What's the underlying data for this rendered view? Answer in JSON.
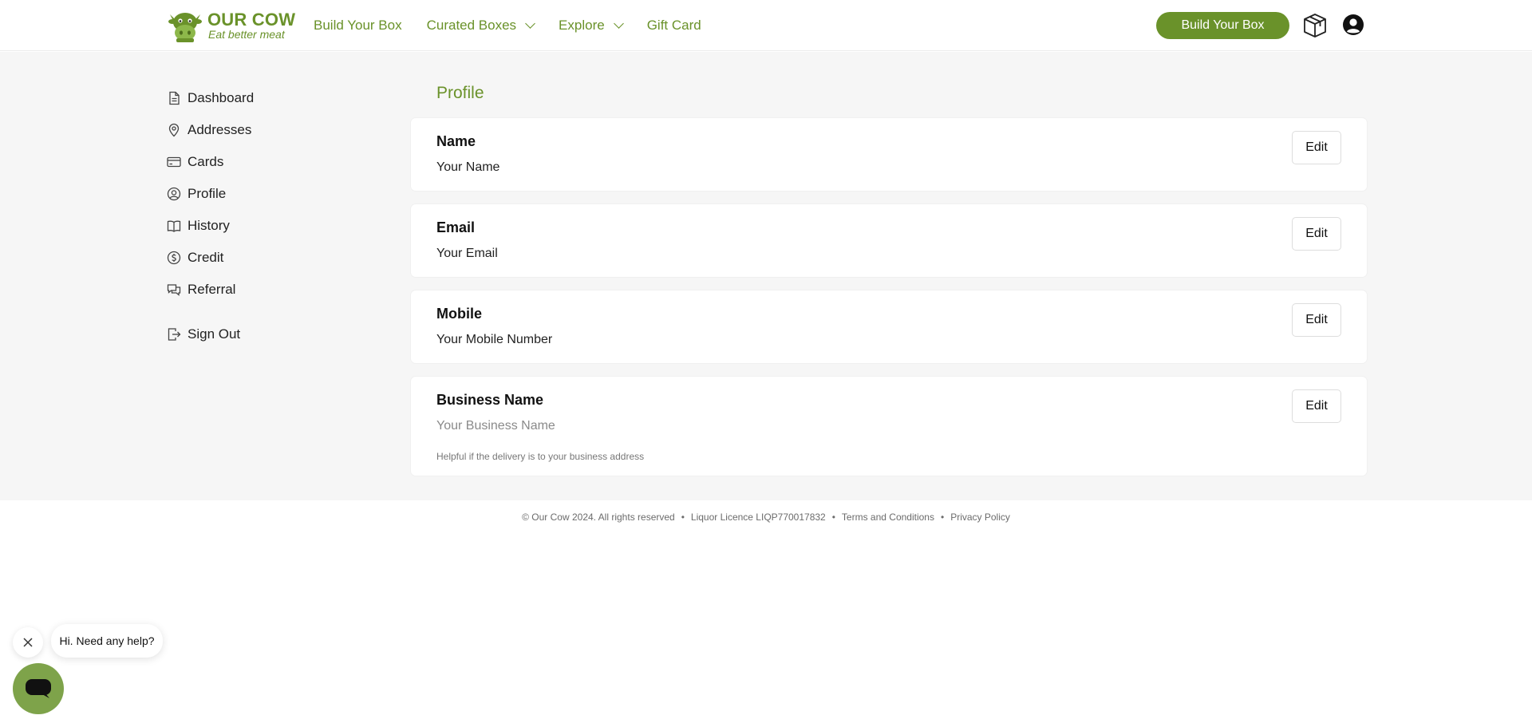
{
  "header": {
    "logo": {
      "brand": "OUR COW",
      "tagline": "Eat better meat"
    },
    "nav": [
      {
        "label": "Build Your Box",
        "dropdown": false
      },
      {
        "label": "Curated Boxes",
        "dropdown": true
      },
      {
        "label": "Explore",
        "dropdown": true
      },
      {
        "label": "Gift Card",
        "dropdown": false
      }
    ],
    "cta_label": "Build Your Box",
    "icons": [
      "box-icon",
      "user-icon"
    ],
    "accent": "#6a922a"
  },
  "sidebar": {
    "items": [
      {
        "label": "Dashboard",
        "icon": "document-icon"
      },
      {
        "label": "Addresses",
        "icon": "location-pin-icon"
      },
      {
        "label": "Cards",
        "icon": "credit-card-icon"
      },
      {
        "label": "Profile",
        "icon": "user-circle-icon"
      },
      {
        "label": "History",
        "icon": "book-icon"
      },
      {
        "label": "Credit",
        "icon": "dollar-circle-icon"
      },
      {
        "label": "Referral",
        "icon": "chat-bubbles-icon"
      }
    ],
    "signout": {
      "label": "Sign Out",
      "icon": "sign-out-icon"
    }
  },
  "profile": {
    "title": "Profile",
    "fields": [
      {
        "label": "Name",
        "value": "Your Name",
        "edit": "Edit"
      },
      {
        "label": "Email",
        "value": "Your Email",
        "edit": "Edit"
      },
      {
        "label": "Mobile",
        "value": "Your Mobile Number",
        "edit": "Edit"
      },
      {
        "label": "Business Name",
        "placeholder": "Your Business Name",
        "hint": "Helpful if the delivery is to your business address",
        "edit": "Edit"
      }
    ]
  },
  "footer": {
    "copyright": "© Our Cow 2024. All rights reserved",
    "licence": "Liquor Licence LIQP770017832",
    "terms": "Terms and Conditions",
    "privacy": "Privacy Policy"
  },
  "chat": {
    "message": "Hi. Need any help?",
    "close_icon": "close-icon",
    "launcher_icon": "chat-icon"
  }
}
